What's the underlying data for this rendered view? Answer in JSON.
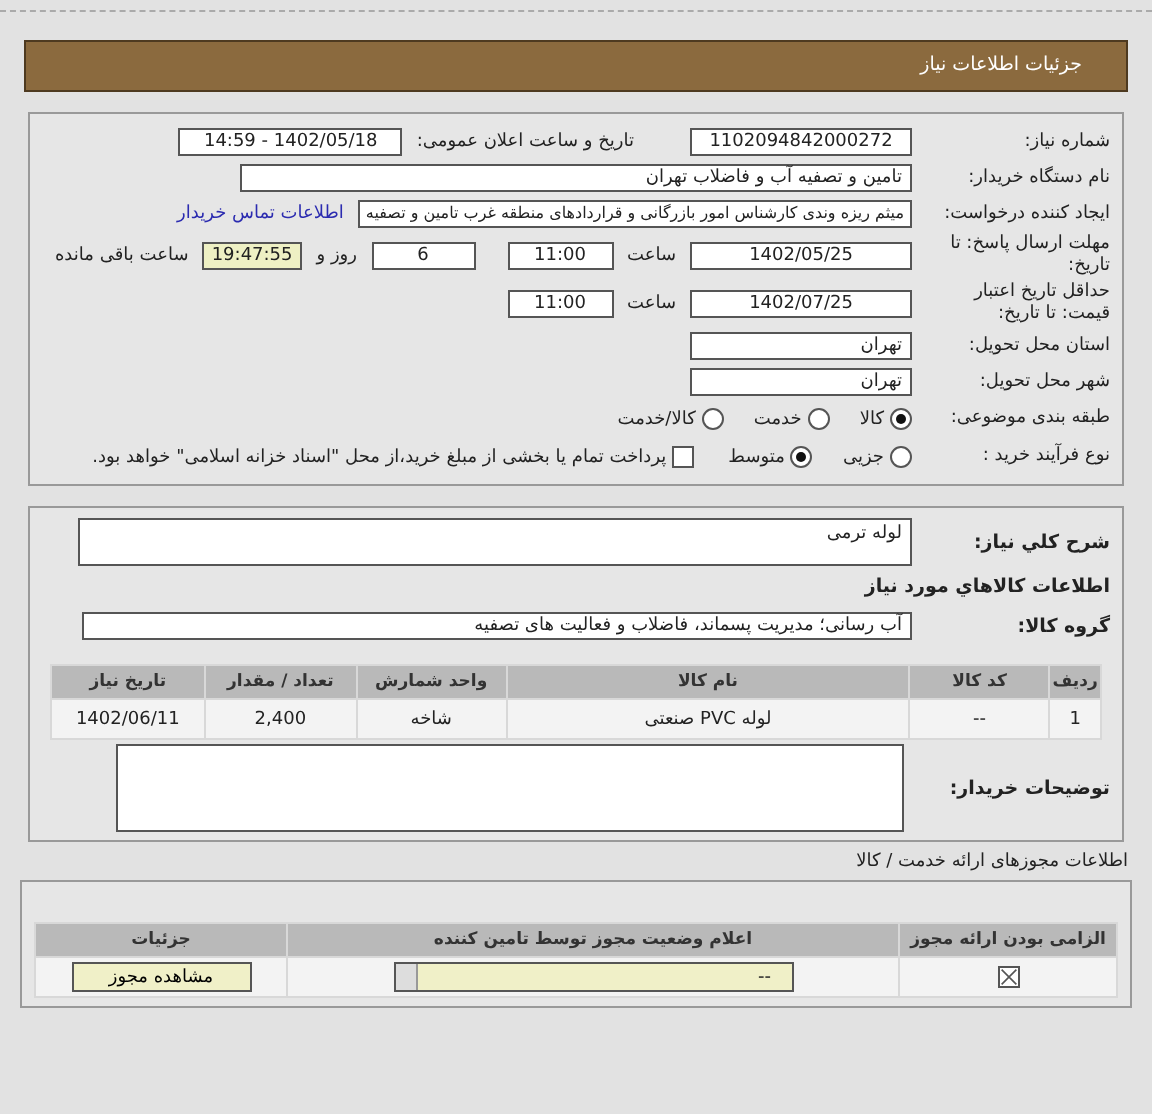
{
  "header": {
    "title": "جزئیات اطلاعات نیاز"
  },
  "details": {
    "need_number": {
      "label": "شماره نیاز:",
      "value": "1102094842000272"
    },
    "announce": {
      "label": "تاريخ و ساعت اعلان عمومی:",
      "value": "1402/05/18 - 14:59"
    },
    "buyer": {
      "label": "نام دستگاه خریدار:",
      "value": "تامین و تصفیه آب و فاضلاب تهران"
    },
    "creator": {
      "label": "ایجاد کننده درخواست:",
      "value": "میثم ریزه وندی کارشناس امور بازرگانی و قراردادهای منطقه غرب تامین و تصفیه",
      "link": "اطلاعات تماس خریدار"
    },
    "deadline": {
      "label": "مهلت ارسال پاسخ: تا تاریخ:",
      "date": "1402/05/25",
      "time_label": "ساعت",
      "time": "11:00",
      "days": "6",
      "days_label": "روز و",
      "remaining": "19:47:55",
      "remaining_label": "ساعت باقی مانده"
    },
    "validity": {
      "label": "حداقل تاريخ اعتبار قیمت: تا تاریخ:",
      "date": "1402/07/25",
      "time_label": "ساعت",
      "time": "11:00"
    },
    "province": {
      "label": "استان محل تحویل:",
      "value": "تهران"
    },
    "city": {
      "label": "شهر محل تحویل:",
      "value": "تهران"
    },
    "category": {
      "label": "طبقه بندی موضوعی:",
      "options": [
        {
          "label": "کالا",
          "selected": true
        },
        {
          "label": "خدمت",
          "selected": false
        },
        {
          "label": "کالا/خدمت",
          "selected": false
        }
      ]
    },
    "process": {
      "label": "نوع فرآیند خرید :",
      "options": [
        {
          "label": "جزیی",
          "selected": false
        },
        {
          "label": "متوسط",
          "selected": true
        }
      ],
      "treasury": {
        "label": "پرداخت تمام یا بخشی از مبلغ خرید،از محل \"اسناد خزانه اسلامی\" خواهد بود.",
        "checked": false
      }
    }
  },
  "needs": {
    "description": {
      "label": "شرح کلي نیاز:",
      "value": "لوله ترمی"
    },
    "goods_title": "اطلاعات کالاهاي مورد نیاز",
    "group": {
      "label": "گروه کالا:",
      "value": "آب رسانی؛ مدیریت پسماند، فاضلاب و فعالیت های تصفیه"
    },
    "table": {
      "columns": [
        "ردیف",
        "کد کالا",
        "نام کالا",
        "واحد شمارش",
        "تعداد / مقدار",
        "تاريخ نیاز"
      ],
      "rows": [
        [
          "1",
          "--",
          "لوله PVC صنعتی",
          "شاخه",
          "2,400",
          "1402/06/11"
        ]
      ]
    },
    "buyer_notes": {
      "label": "توضیحات خریدار:"
    }
  },
  "permits": {
    "title": "اطلاعات مجوزهای ارائه خدمت / کالا",
    "columns": [
      "الزامی بودن ارائه مجوز",
      "اعلام وضعیت مجوز توسط تامین کننده",
      "جزئیات"
    ],
    "rows": [
      {
        "required": true,
        "status": "--",
        "button": "مشاهده مجوز"
      }
    ]
  }
}
